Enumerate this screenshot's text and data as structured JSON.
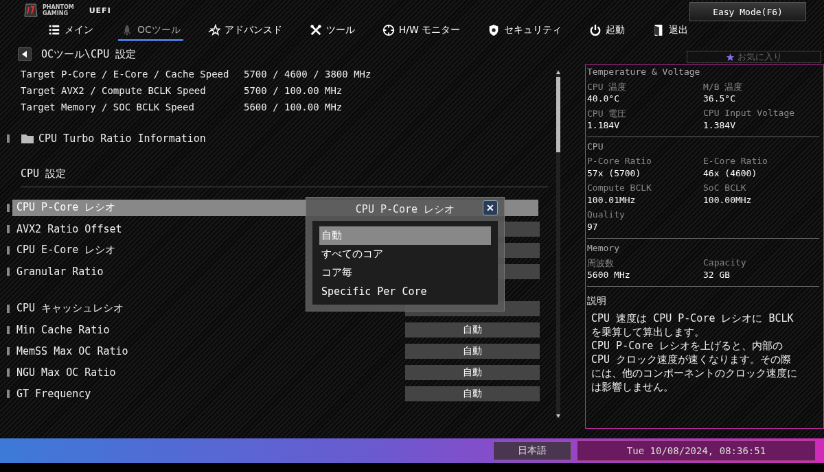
{
  "header": {
    "brand_line_1": "PHANTOM",
    "brand_line_2": "GAMING",
    "uefi": "UEFI",
    "easy_mode_button": "Easy Mode(F6)"
  },
  "tabs": [
    {
      "label": "メイン",
      "selected": false
    },
    {
      "label": "OCツール",
      "selected": true
    },
    {
      "label": "アドバンスド",
      "selected": false
    },
    {
      "label": "ツール",
      "selected": false
    },
    {
      "label": "H/W モニター",
      "selected": false
    },
    {
      "label": "セキュリティ",
      "selected": false
    },
    {
      "label": "起動",
      "selected": false
    },
    {
      "label": "退出",
      "selected": false
    }
  ],
  "breadcrumb": "OCツール\\CPU 設定",
  "favorites_button": "お気に入り",
  "info_rows": [
    {
      "label": "Target P-Core / E-Core / Cache Speed",
      "value": "5700 / 4600 / 3800 MHz"
    },
    {
      "label": "Target AVX2 / Compute BCLK Speed",
      "value": "5700 / 100.00 MHz"
    },
    {
      "label": "Target Memory / SOC BCLK Speed",
      "value": "5600 / 100.00 MHz"
    }
  ],
  "folder_item": "CPU Turbo Ratio Information",
  "section_title": "CPU 設定",
  "settings": [
    {
      "label": "CPU P-Core レシオ",
      "selected": true,
      "gap_before": false
    },
    {
      "label": "AVX2 Ratio Offset",
      "selected": false,
      "gap_before": false
    },
    {
      "label": "CPU E-Core レシオ",
      "selected": false,
      "gap_before": false
    },
    {
      "label": "Granular Ratio",
      "selected": false,
      "gap_before": false
    },
    {
      "label": "CPU  キャッシュレシオ",
      "selected": false,
      "gap_before": true
    },
    {
      "label": "Min Cache  Ratio",
      "value": "自動",
      "selected": false,
      "gap_before": false
    },
    {
      "label": "MemSS Max OC Ratio",
      "value": "自動",
      "selected": false,
      "gap_before": false
    },
    {
      "label": "NGU Max OC Ratio",
      "value": "自動",
      "selected": false,
      "gap_before": false
    },
    {
      "label": "GT Frequency",
      "value": "自動",
      "selected": false,
      "gap_before": false
    }
  ],
  "popup": {
    "title": "CPU P-Core レシオ",
    "close": "✕",
    "options": [
      {
        "label": "自動",
        "selected": true
      },
      {
        "label": "すべてのコア",
        "selected": false
      },
      {
        "label": "コア毎",
        "selected": false
      },
      {
        "label": "Specific Per Core",
        "selected": false
      }
    ]
  },
  "monitor": [
    {
      "title": "Temperature & Voltage",
      "items": [
        {
          "label": "CPU 温度",
          "value": "40.0°C"
        },
        {
          "label": "M/B 温度",
          "value": "36.5°C"
        },
        {
          "label": "CPU 電圧",
          "value": "1.184V"
        },
        {
          "label": "CPU Input Voltage",
          "value": "1.384V"
        }
      ]
    },
    {
      "title": "CPU",
      "items": [
        {
          "label": "P-Core Ratio",
          "value": "57x (5700)"
        },
        {
          "label": "E-Core Ratio",
          "value": "46x (4600)"
        },
        {
          "label": "Compute BCLK",
          "value": "100.01MHz"
        },
        {
          "label": "SoC BCLK",
          "value": "100.00MHz"
        },
        {
          "label": "Quality",
          "value": "97"
        }
      ]
    },
    {
      "title": "Memory",
      "items": [
        {
          "label": "周波数",
          "value": "5600 MHz"
        },
        {
          "label": "Capacity",
          "value": "32 GB"
        }
      ]
    }
  ],
  "description": {
    "title": "説明",
    "text": "CPU 速度は CPU P-Core レシオに BCLK を乗算して算出します。\nCPU P-Core レシオを上げると、内部の CPU クロック速度が速くなります。その際には、他のコンポーネントのクロック速度には影響しません。"
  },
  "status_bar": {
    "language": "日本語",
    "datetime": "Tue 10/08/2024, 08:36:51"
  }
}
